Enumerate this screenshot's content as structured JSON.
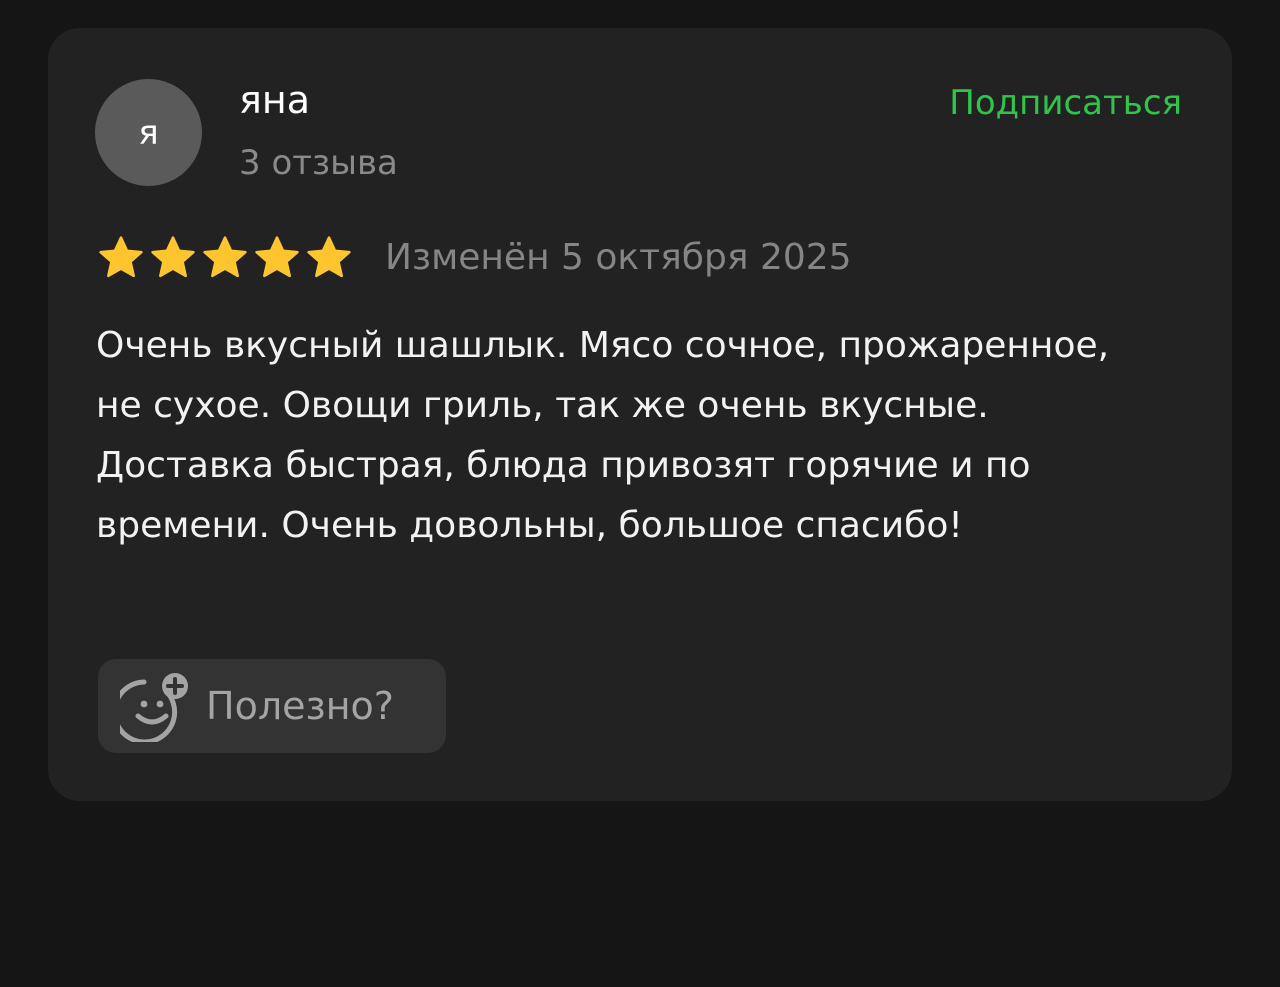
{
  "author": {
    "avatar_letter": "я",
    "name": "яна",
    "reviews_count": "3 отзыва"
  },
  "actions": {
    "subscribe_label": "Подписаться",
    "helpful_label": "Полезно?",
    "helpful_icon": "smiley-plus-icon"
  },
  "review": {
    "rating": 5,
    "rating_max": 5,
    "date": "Изменён 5 октября 2025",
    "text": "Очень вкусный шашлык. Мясо сочное, прожаренное, не сухое. Овощи гриль, так же очень вкусные. Доставка быстрая, блюда привозят горячие и по времени. Очень довольны, большое спасибо!"
  },
  "colors": {
    "background": "#151515",
    "card": "#222222",
    "accent_green": "#2fc549",
    "star_yellow": "#ffc52e",
    "avatar_bg": "#5a5a5a",
    "button_bg": "#333333"
  }
}
